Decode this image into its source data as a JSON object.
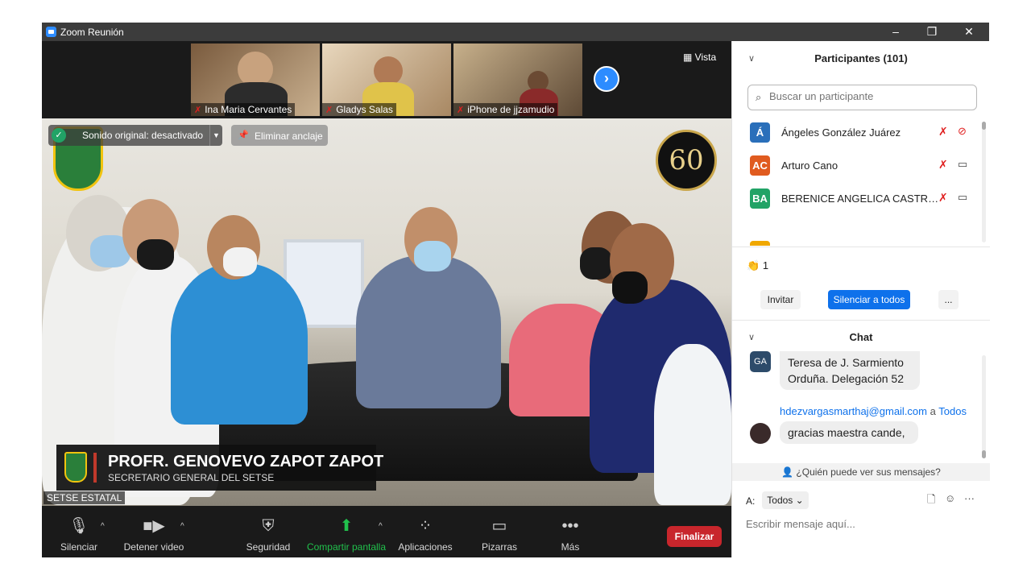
{
  "window": {
    "title": "Zoom Reunión",
    "controls": {
      "minimize": "–",
      "restore": "❐",
      "close": "✕"
    }
  },
  "thumbnails": [
    {
      "name": "Ina Maria Cervantes",
      "bg": "#8a6b4e"
    },
    {
      "name": "Gladys Salas",
      "bg": "#d9b48a"
    },
    {
      "name": "iPhone de jjzamudio",
      "bg": "#b9a07d"
    }
  ],
  "view_label": "Vista",
  "main_video": {
    "sound_label": "Sonido original: desactivado",
    "unpin_label": "Eliminar anclaje",
    "badge_60": "60",
    "lower_third": {
      "name": "PROFR. GENOVEVO ZAPOT ZAPOT",
      "role": "SECRETARIO GENERAL DEL SETSE"
    },
    "speaker_label": "SETSE ESTATAL"
  },
  "toolbar": {
    "mute": "Silenciar",
    "video": "Detener video",
    "security": "Seguridad",
    "share": "Compartir pantalla",
    "apps": "Aplicaciones",
    "whiteboard": "Pizarras",
    "more": "Más",
    "end": "Finalizar"
  },
  "participants": {
    "header": "Participantes (101)",
    "search_placeholder": "Buscar un participante",
    "list": [
      {
        "initials": "Á",
        "name": "Ángeles González Juárez",
        "color": "#2a6fba"
      },
      {
        "initials": "AC",
        "name": "Arturo Cano",
        "color": "#e05b1f"
      },
      {
        "initials": "BA",
        "name": "BERENICE ANGELICA CASTRO ...",
        "color": "#21a366"
      }
    ],
    "reaction_count": "1",
    "invite": "Invitar",
    "mute_all": "Silenciar a todos",
    "more": "..."
  },
  "chat": {
    "header": "Chat",
    "messages": [
      {
        "avatar": "GA",
        "text_line1": "Teresa de J. Sarmiento",
        "text_line2": "Orduña. Delegación 52"
      },
      {
        "from": "hdezvargasmarthaj@gmail.com",
        "a": "a",
        "to": "Todos",
        "text": "gracias maestra cande,"
      }
    ],
    "who_sees": "¿Quién puede ver sus mensajes?",
    "to_label": "A:",
    "to_value": "Todos",
    "input_placeholder": "Escribir mensaje aquí..."
  }
}
